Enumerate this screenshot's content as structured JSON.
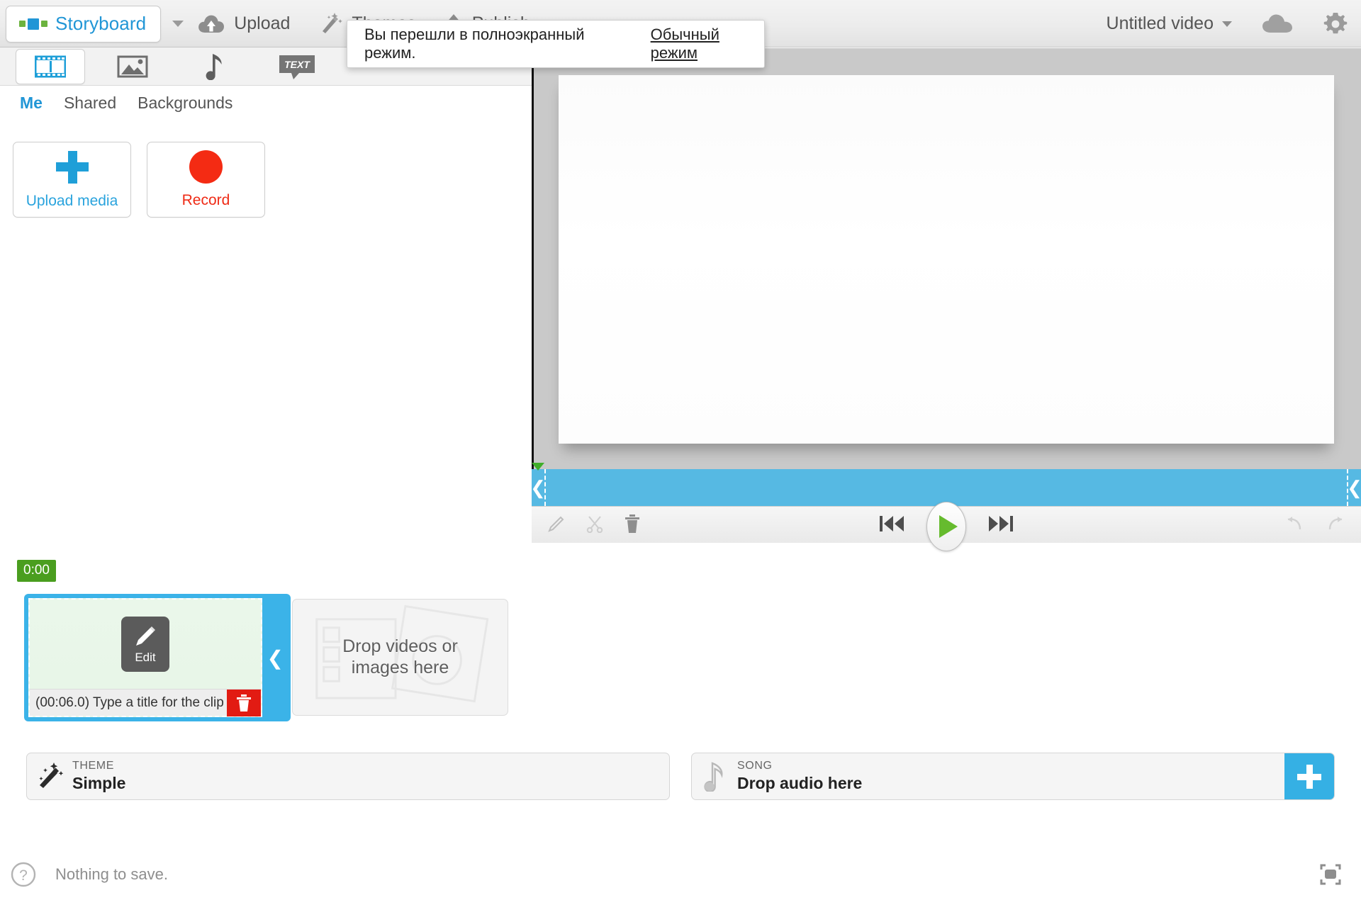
{
  "topbar": {
    "brand": "Storyboard",
    "brand_caret": "chevron-down",
    "nav": [
      {
        "label": "Upload",
        "icon": "cloud-upload-icon"
      },
      {
        "label": "Themes",
        "icon": "magic-wand-icon"
      },
      {
        "label": "Publish",
        "icon": "upload-arrow-icon"
      }
    ],
    "video_title": "Untitled video",
    "cloud_icon": "cloud-icon",
    "settings_icon": "gear-icon"
  },
  "notice": {
    "message": "Вы перешли в полноэкранный режим.",
    "action": "Обычный режим"
  },
  "library": {
    "tabs": [
      {
        "icon": "film-strip-icon",
        "active": true
      },
      {
        "icon": "image-icon",
        "active": false
      },
      {
        "icon": "music-note-icon",
        "active": false
      },
      {
        "icon": "text-bubble-icon",
        "active": false,
        "label": "TEXT"
      }
    ],
    "subtabs": [
      {
        "label": "Me",
        "active": true
      },
      {
        "label": "Shared",
        "active": false
      },
      {
        "label": "Backgrounds",
        "active": false
      }
    ],
    "buttons": [
      {
        "label": "Upload media",
        "icon": "plus-icon",
        "color": "#29a3dd"
      },
      {
        "label": "Record",
        "icon": "record-dot-icon",
        "color": "#ef2b16"
      }
    ]
  },
  "player": {
    "toolbar_left": [
      {
        "icon": "pencil-icon",
        "enabled": false
      },
      {
        "icon": "scissors-icon",
        "enabled": false
      },
      {
        "icon": "trash-icon",
        "enabled": true
      }
    ],
    "transport": [
      {
        "icon": "skip-back-icon"
      },
      {
        "icon": "play-icon"
      },
      {
        "icon": "skip-forward-icon"
      }
    ],
    "toolbar_right": [
      {
        "icon": "undo-icon",
        "enabled": false
      },
      {
        "icon": "redo-icon",
        "enabled": false
      }
    ],
    "scrub_left_handle": "❮",
    "scrub_right_handle": "❮"
  },
  "timeline": {
    "time_badge": "0:00",
    "clip": {
      "edit_label": "Edit",
      "edit_icon": "pencil-icon",
      "caption": "(00:06.0) Type a title for the clip",
      "delete_icon": "trash-icon",
      "collapse_icon": "chevron-left-icon"
    },
    "dropzone": {
      "line1": "Drop videos or",
      "line2": "images here",
      "icon": "film-frames-icon"
    }
  },
  "strips": {
    "theme": {
      "kicker": "THEME",
      "value": "Simple",
      "icon": "magic-wand-icon"
    },
    "song": {
      "kicker": "SONG",
      "value": "Drop audio here",
      "icon": "music-note-icon",
      "add_icon": "plus-icon"
    }
  },
  "footer": {
    "help_icon": "question-circle-icon",
    "status": "Nothing to save.",
    "expand_icon": "expand-icon"
  },
  "colors": {
    "accent_blue": "#2196d6",
    "scrub_blue": "#56b9e3",
    "clip_blue": "#3bb3e8",
    "record_red": "#f42b13",
    "delete_red": "#e21b13",
    "play_green": "#66bb2e",
    "badge_green": "#4a9e1f"
  }
}
